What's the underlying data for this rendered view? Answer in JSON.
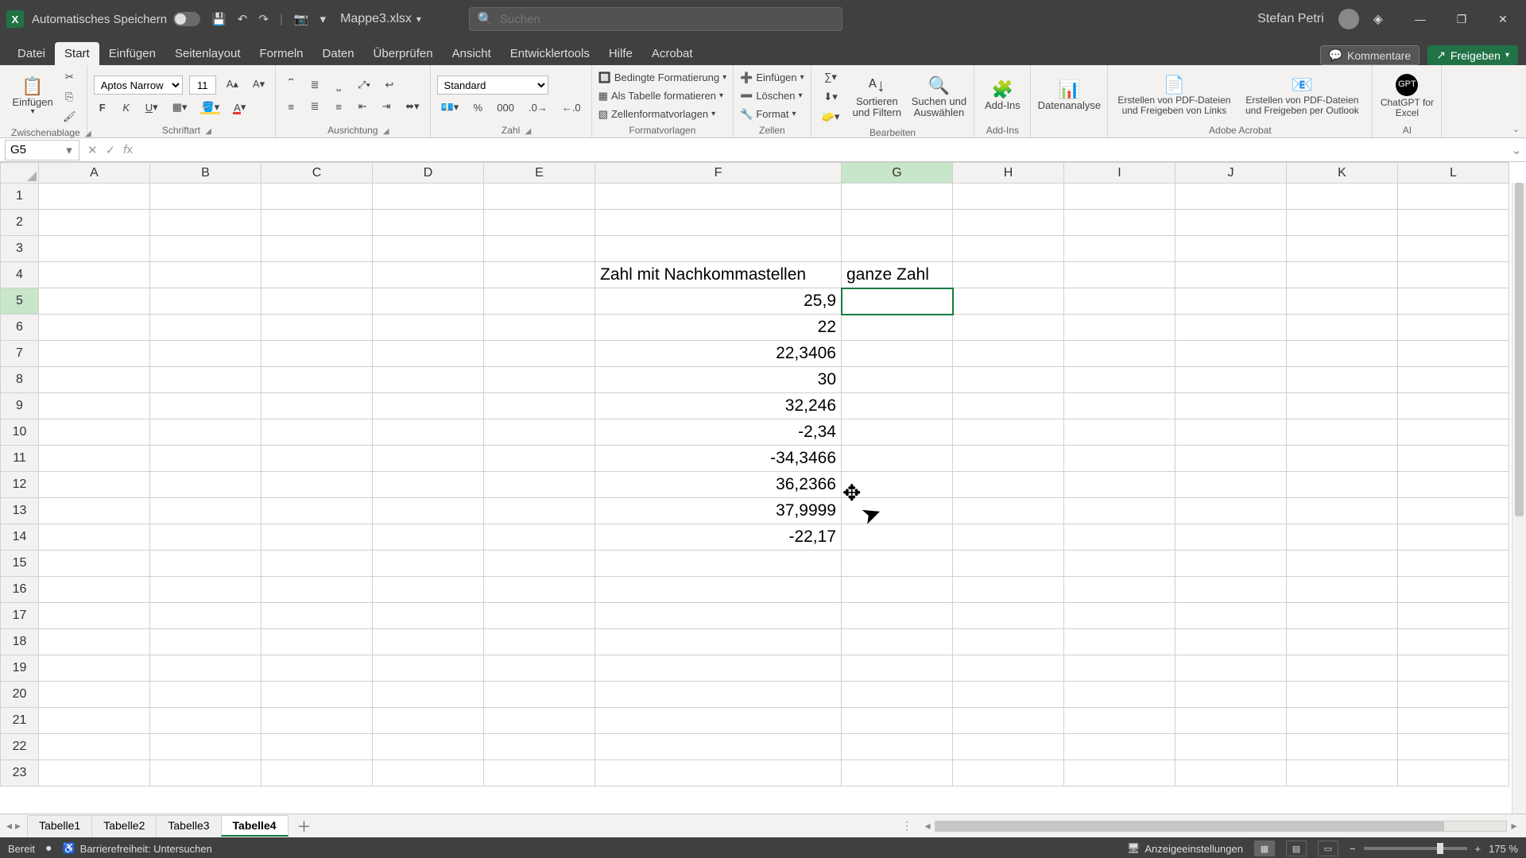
{
  "title": {
    "autosave": "Automatisches Speichern",
    "docname": "Mappe3.xlsx",
    "search_placeholder": "Suchen",
    "username": "Stefan Petri"
  },
  "winctrl": {
    "min": "—",
    "max": "❐",
    "close": "✕"
  },
  "menu": {
    "tabs": [
      "Datei",
      "Start",
      "Einfügen",
      "Seitenlayout",
      "Formeln",
      "Daten",
      "Überprüfen",
      "Ansicht",
      "Entwicklertools",
      "Hilfe",
      "Acrobat"
    ],
    "active": 1,
    "comments": "Kommentare",
    "share": "Freigeben"
  },
  "ribbon": {
    "clip": {
      "paste": "Einfügen",
      "label": "Zwischenablage"
    },
    "font": {
      "family": "Aptos Narrow",
      "size": "11",
      "label": "Schriftart"
    },
    "align": {
      "label": "Ausrichtung"
    },
    "number": {
      "fmt": "Standard",
      "label": "Zahl"
    },
    "styles": {
      "cond": "Bedingte Formatierung",
      "table": "Als Tabelle formatieren",
      "cell": "Zellenformatvorlagen",
      "label": "Formatvorlagen"
    },
    "cells": {
      "ins": "Einfügen",
      "del": "Löschen",
      "fmt": "Format",
      "label": "Zellen"
    },
    "edit": {
      "sort": "Sortieren und Filtern",
      "find": "Suchen und Auswählen",
      "label": "Bearbeiten"
    },
    "addin": {
      "name": "Add-Ins",
      "label": "Add-Ins"
    },
    "analysis": {
      "name": "Datenanalyse"
    },
    "acro": {
      "a": "Erstellen von PDF-Dateien und Freigeben von Links",
      "b": "Erstellen von PDF-Dateien und Freigeben per Outlook",
      "label": "Adobe Acrobat"
    },
    "ai": {
      "name": "ChatGPT for Excel",
      "label": "AI"
    }
  },
  "fx": {
    "cellref": "G5",
    "formula": ""
  },
  "grid": {
    "cols": [
      "A",
      "B",
      "C",
      "D",
      "E",
      "F",
      "G",
      "H",
      "I",
      "J",
      "K",
      "L"
    ],
    "rowcount": 23,
    "active": {
      "col": "G",
      "row": 5
    },
    "cells": {
      "F4": "Zahl mit Nachkommastellen",
      "G4": "ganze Zahl",
      "F5": "25,9",
      "F6": "22",
      "F7": "22,3406",
      "F8": "30",
      "F9": "32,246",
      "F10": "-2,34",
      "F11": "-34,3466",
      "F12": "36,2366",
      "F13": "37,9999",
      "F14": "-22,17"
    }
  },
  "sheets": {
    "tabs": [
      "Tabelle1",
      "Tabelle2",
      "Tabelle3",
      "Tabelle4"
    ],
    "active": 3
  },
  "status": {
    "ready": "Bereit",
    "access": "Barrierefreiheit: Untersuchen",
    "disp": "Anzeigeeinstellungen",
    "zoom": "175 %"
  }
}
